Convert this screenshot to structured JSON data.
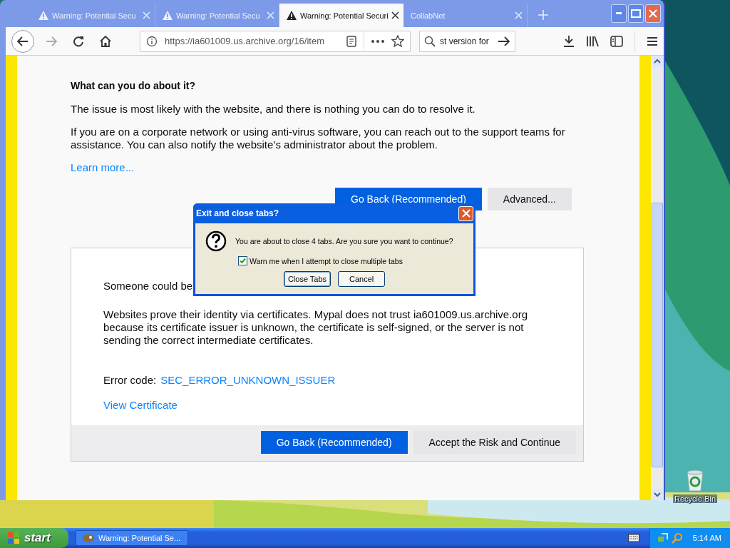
{
  "browser": {
    "tabs": [
      {
        "title": "Warning: Potential Secu",
        "kind": "warning",
        "selected": false
      },
      {
        "title": "Warning: Potential Secu",
        "kind": "warning",
        "selected": false
      },
      {
        "title": "Warning: Potential Securi",
        "kind": "warning",
        "selected": true
      },
      {
        "title": "CollabNet",
        "kind": "plain",
        "selected": false
      }
    ],
    "address": "https://ia601009.us.archive.org/16/item",
    "search": "st version for"
  },
  "page": {
    "heading": "What can you do about it?",
    "paragraphs": [
      "The issue is most likely with the website, and there is nothing you can do to resolve it.",
      "If you are on a corporate network or using anti-virus software, you can reach out to the support teams for assistance. You can also notify the website’s administrator about the problem."
    ],
    "learn_more": "Learn more...",
    "buttons": [
      "Go Back (Recommended)",
      "Advanced..."
    ],
    "details": {
      "intro": "Someone could be",
      "text": "Websites prove their identity via certificates. Mypal does not trust ia601009.us.archive.org because its certificate issuer is unknown, the certificate is self-signed, or the server is not sending the correct intermediate certificates.",
      "error_label": "Error code:",
      "error_code": "SEC_ERROR_UNKNOWN_ISSUER",
      "view_certificate": "View Certificate",
      "buttons": [
        "Go Back (Recommended)",
        "Accept the Risk and Continue"
      ]
    }
  },
  "dialog": {
    "title": "Exit and close tabs?",
    "message": "You are about to close 4 tabs. Are you sure you want to continue?",
    "checkbox": {
      "label": "Warn me when I attempt to close multiple tabs",
      "checked": true
    },
    "buttons": [
      "Close Tabs",
      "Cancel"
    ]
  },
  "desktop": {
    "icons": [
      {
        "label": "Recycle Bin"
      }
    ]
  },
  "taskbar": {
    "start": "start",
    "tasks": [
      {
        "title": "Warning: Potential Se...",
        "selected": false
      }
    ],
    "clock": "5:14 AM"
  }
}
